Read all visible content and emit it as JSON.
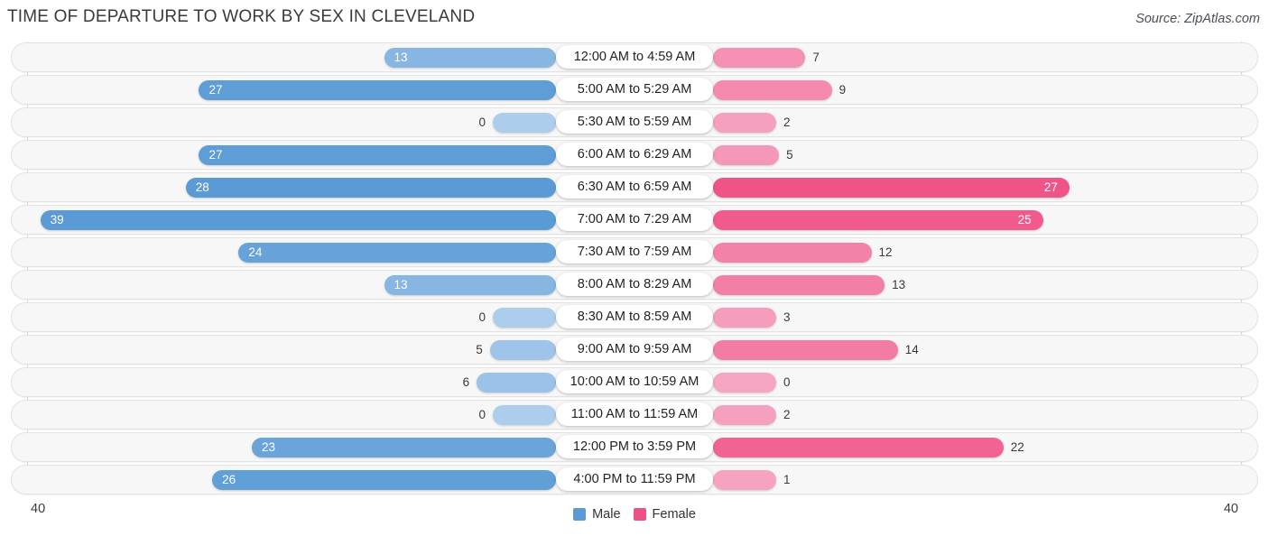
{
  "header": {
    "title": "TIME OF DEPARTURE TO WORK BY SEX IN CLEVELAND",
    "source": "Source: ZipAtlas.com"
  },
  "axis": {
    "left_label": "40",
    "right_label": "40"
  },
  "legend": {
    "items": [
      {
        "label": "Male",
        "color": "#5b9bd5",
        "icon": "male-swatch"
      },
      {
        "label": "Female",
        "color": "#ef5185",
        "icon": "female-swatch"
      }
    ]
  },
  "chart_data": {
    "type": "bar",
    "title": "TIME OF DEPARTURE TO WORK BY SEX IN CLEVELAND",
    "subtitle": "",
    "orientation": "horizontal-diverging",
    "xlabel": "",
    "ylabel": "",
    "xlim": [
      40,
      40
    ],
    "grid": true,
    "legend_position": "bottom-center",
    "categories": [
      "12:00 AM to 4:59 AM",
      "5:00 AM to 5:29 AM",
      "5:30 AM to 5:59 AM",
      "6:00 AM to 6:29 AM",
      "6:30 AM to 6:59 AM",
      "7:00 AM to 7:29 AM",
      "7:30 AM to 7:59 AM",
      "8:00 AM to 8:29 AM",
      "8:30 AM to 8:59 AM",
      "9:00 AM to 9:59 AM",
      "10:00 AM to 10:59 AM",
      "11:00 AM to 11:59 AM",
      "12:00 PM to 3:59 PM",
      "4:00 PM to 11:59 PM"
    ],
    "series": [
      {
        "name": "Male",
        "color": "#5b9bd5",
        "direction": "left",
        "values": [
          13,
          27,
          0,
          27,
          28,
          39,
          24,
          13,
          0,
          5,
          6,
          0,
          23,
          26
        ]
      },
      {
        "name": "Female",
        "color": "#ef5185",
        "direction": "right",
        "values": [
          7,
          9,
          2,
          5,
          27,
          25,
          12,
          13,
          3,
          14,
          0,
          2,
          22,
          1
        ]
      }
    ]
  }
}
